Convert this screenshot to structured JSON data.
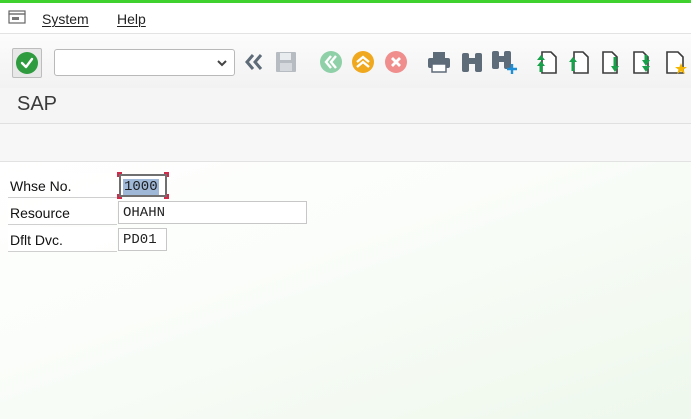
{
  "menu": {
    "system_label": "System",
    "help_label": "Help"
  },
  "toolbar": {
    "command_field_value": "",
    "icons": [
      "enter-icon",
      "back-double-chevron-icon",
      "save-icon",
      "back-icon",
      "exit-icon",
      "cancel-icon",
      "print-icon",
      "find-icon",
      "find-next-icon",
      "first-page-icon",
      "previous-page-icon",
      "next-page-icon",
      "last-page-icon",
      "create-shortcut-icon"
    ]
  },
  "title": "SAP",
  "form": {
    "whse": {
      "label": "Whse No.",
      "value": "1000"
    },
    "resource": {
      "label": "Resource",
      "value": "OHAHN"
    },
    "device": {
      "label": "Dflt Dvc.",
      "value": "PD01"
    }
  },
  "colors": {
    "accent_bar": "#3fd22f",
    "enter_green": "#2e9b3f",
    "back_green": "#8fd0a8",
    "exit_orange": "#f0a81e",
    "cancel_red": "#f08d8d",
    "nav_green": "#19a04a",
    "focus_marker": "#d12b4b"
  }
}
